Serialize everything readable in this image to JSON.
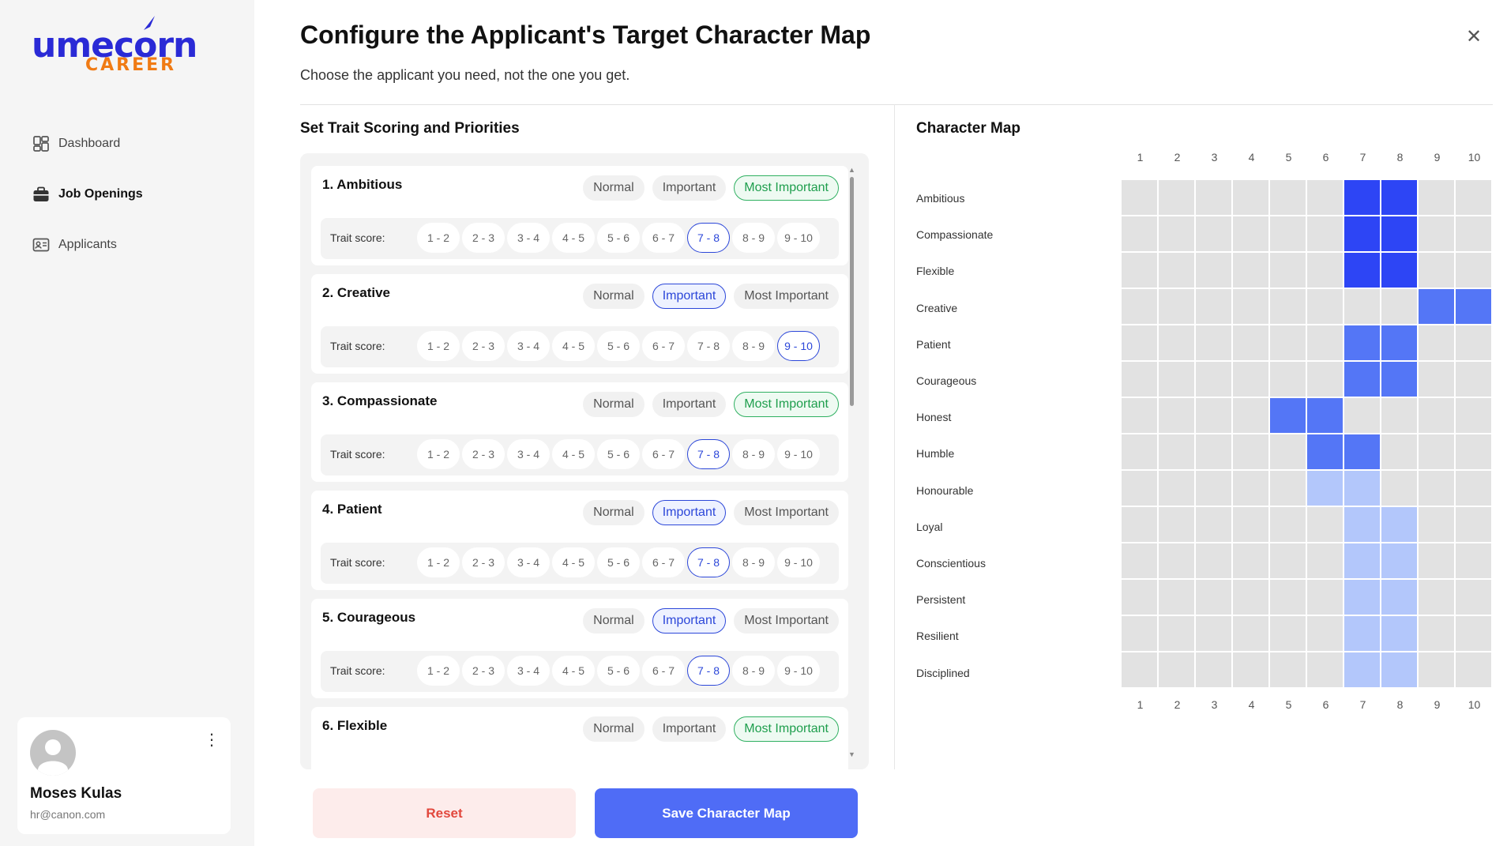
{
  "brand": {
    "word": "umecorn",
    "sub": "CAREER"
  },
  "nav": [
    {
      "label": "Dashboard",
      "icon": "dashboard-icon",
      "active": false
    },
    {
      "label": "Job Openings",
      "icon": "briefcase-icon",
      "active": true
    },
    {
      "label": "Applicants",
      "icon": "id-card-icon",
      "active": false
    }
  ],
  "user": {
    "name": "Moses Kulas",
    "email": "hr@canon.com"
  },
  "header": {
    "title": "Configure the Applicant's Target Character Map",
    "subtitle": "Choose the applicant you need, not the one you get."
  },
  "left_title": "Set Trait Scoring and Priorities",
  "right_title": "Character Map",
  "priority_options": [
    "Normal",
    "Important",
    "Most Important"
  ],
  "score_label": "Trait score:",
  "score_options": [
    "1 - 2",
    "2 - 3",
    "3 - 4",
    "4 - 5",
    "5 - 6",
    "6 - 7",
    "7 - 8",
    "8 - 9",
    "9 - 10"
  ],
  "traits": [
    {
      "name": "1. Ambitious",
      "priority": "Most Important",
      "score": "7 - 8"
    },
    {
      "name": "2. Creative",
      "priority": "Important",
      "score": "9 - 10"
    },
    {
      "name": "3. Compassionate",
      "priority": "Most Important",
      "score": "7 - 8"
    },
    {
      "name": "4. Patient",
      "priority": "Important",
      "score": "7 - 8"
    },
    {
      "name": "5. Courageous",
      "priority": "Important",
      "score": "7 - 8"
    },
    {
      "name": "6. Flexible",
      "priority": "Most Important",
      "score": null
    }
  ],
  "buttons": {
    "reset": "Reset",
    "save": "Save Character Map"
  },
  "map": {
    "columns": [
      "1",
      "2",
      "3",
      "4",
      "5",
      "6",
      "7",
      "8",
      "9",
      "10"
    ],
    "colors": {
      "empty": "#e2e2e2",
      "most": "#2d45f5",
      "important": "#5476f6",
      "normal": "#b3c7fb"
    },
    "rows": [
      {
        "label": "Ambitious",
        "range": [
          7,
          8
        ],
        "level": "most"
      },
      {
        "label": "Compassionate",
        "range": [
          7,
          8
        ],
        "level": "most"
      },
      {
        "label": "Flexible",
        "range": [
          7,
          8
        ],
        "level": "most"
      },
      {
        "label": "Creative",
        "range": [
          9,
          10
        ],
        "level": "important"
      },
      {
        "label": "Patient",
        "range": [
          7,
          8
        ],
        "level": "important"
      },
      {
        "label": "Courageous",
        "range": [
          7,
          8
        ],
        "level": "important"
      },
      {
        "label": "Honest",
        "range": [
          5,
          6
        ],
        "level": "important"
      },
      {
        "label": "Humble",
        "range": [
          6,
          7
        ],
        "level": "important"
      },
      {
        "label": "Honourable",
        "range": [
          6,
          7
        ],
        "level": "normal"
      },
      {
        "label": "Loyal",
        "range": [
          7,
          8
        ],
        "level": "normal"
      },
      {
        "label": "Conscientious",
        "range": [
          7,
          8
        ],
        "level": "normal"
      },
      {
        "label": "Persistent",
        "range": [
          7,
          8
        ],
        "level": "normal"
      },
      {
        "label": "Resilient",
        "range": [
          7,
          8
        ],
        "level": "normal"
      },
      {
        "label": "Disciplined",
        "range": [
          7,
          8
        ],
        "level": "normal"
      }
    ]
  }
}
